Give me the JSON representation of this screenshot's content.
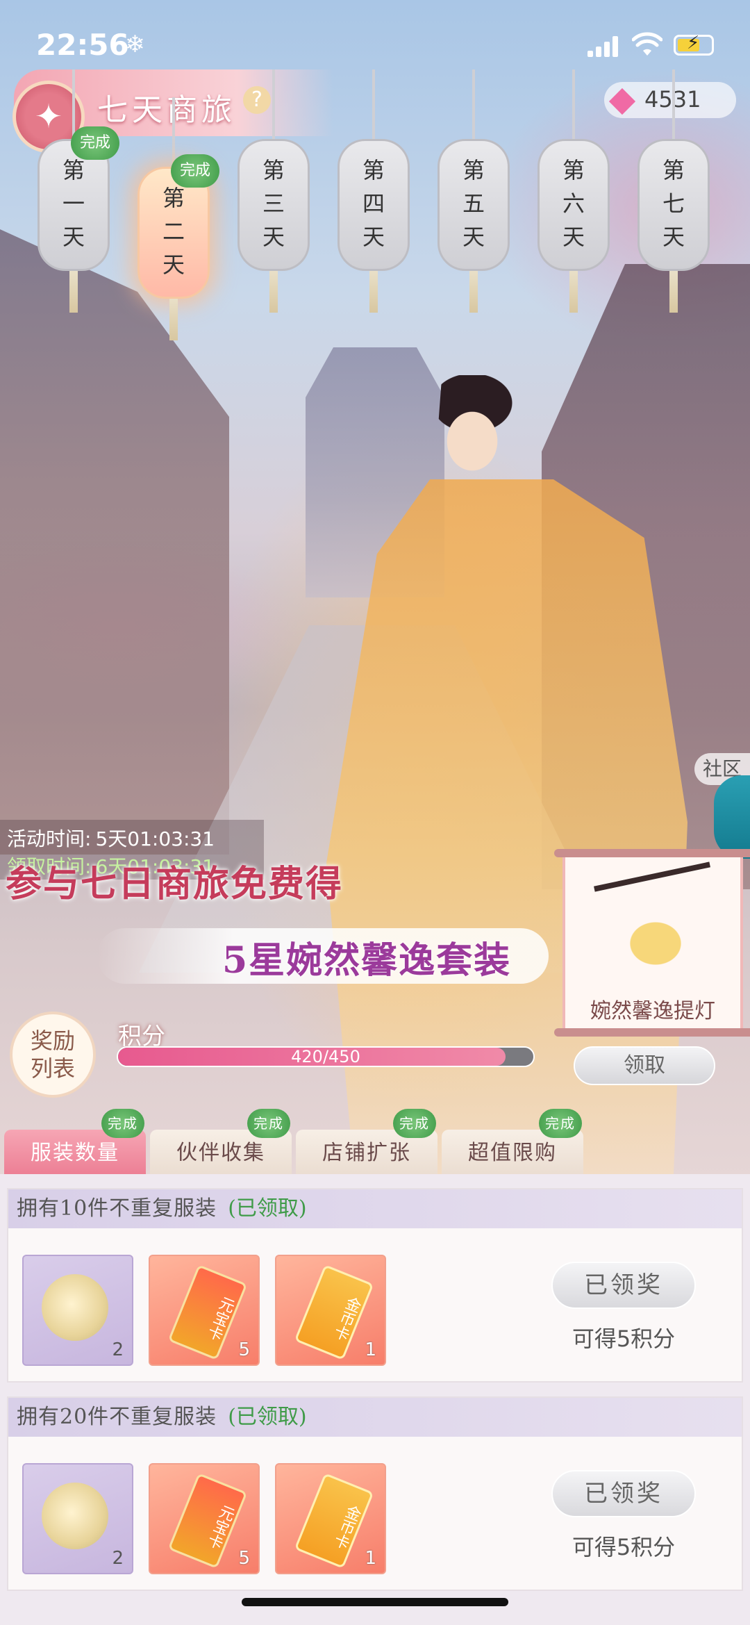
{
  "status_bar": {
    "time": "22:56",
    "snow_glyph": "❄"
  },
  "header": {
    "title": "七天商旅",
    "help_glyph": "?",
    "gem_count": "4531",
    "back_glyph": "✦"
  },
  "days": [
    {
      "label": "第一天",
      "done": "完成"
    },
    {
      "label": "第二天",
      "done": "完成"
    },
    {
      "label": "第三天",
      "done": ""
    },
    {
      "label": "第四天",
      "done": ""
    },
    {
      "label": "第五天",
      "done": ""
    },
    {
      "label": "第六天",
      "done": ""
    },
    {
      "label": "第七天",
      "done": ""
    }
  ],
  "side": {
    "community": "社区"
  },
  "activity": {
    "activity_label": "活动时间:",
    "activity_value": "5天01:03:31",
    "claim_label": "领取时间:",
    "claim_value": "6天01:03:31"
  },
  "promo": {
    "line1": "参与七日商旅免费得",
    "line2": "5星婉然馨逸套装"
  },
  "reward_item": {
    "name": "婉然馨逸提灯"
  },
  "reward_list": {
    "line1": "奖励",
    "line2": "列表"
  },
  "score": {
    "label": "积分",
    "text": "420/450",
    "current": 420,
    "max": 450,
    "claim_label": "领取"
  },
  "tabs": [
    {
      "label": "服装数量",
      "done": "完成"
    },
    {
      "label": "伙伴收集",
      "done": "完成"
    },
    {
      "label": "店铺扩张",
      "done": "完成"
    },
    {
      "label": "超值限购",
      "done": "完成"
    }
  ],
  "tasks": [
    {
      "title": "拥有10件不重复服装",
      "state": "(已领取)",
      "items": [
        {
          "count": "2"
        },
        {
          "count": "5",
          "text": "元宝卡"
        },
        {
          "count": "1",
          "text": "金币卡"
        }
      ],
      "button": "已领奖",
      "points": "可得5积分"
    },
    {
      "title": "拥有20件不重复服装",
      "state": "(已领取)",
      "items": [
        {
          "count": "2"
        },
        {
          "count": "5",
          "text": "元宝卡"
        },
        {
          "count": "1",
          "text": "金币卡"
        }
      ],
      "button": "已领奖",
      "points": "可得5积分"
    }
  ],
  "colors": {
    "accent_pink": "#ec7d93",
    "done_green": "#3f9b48",
    "progress": "#e75a8f"
  }
}
